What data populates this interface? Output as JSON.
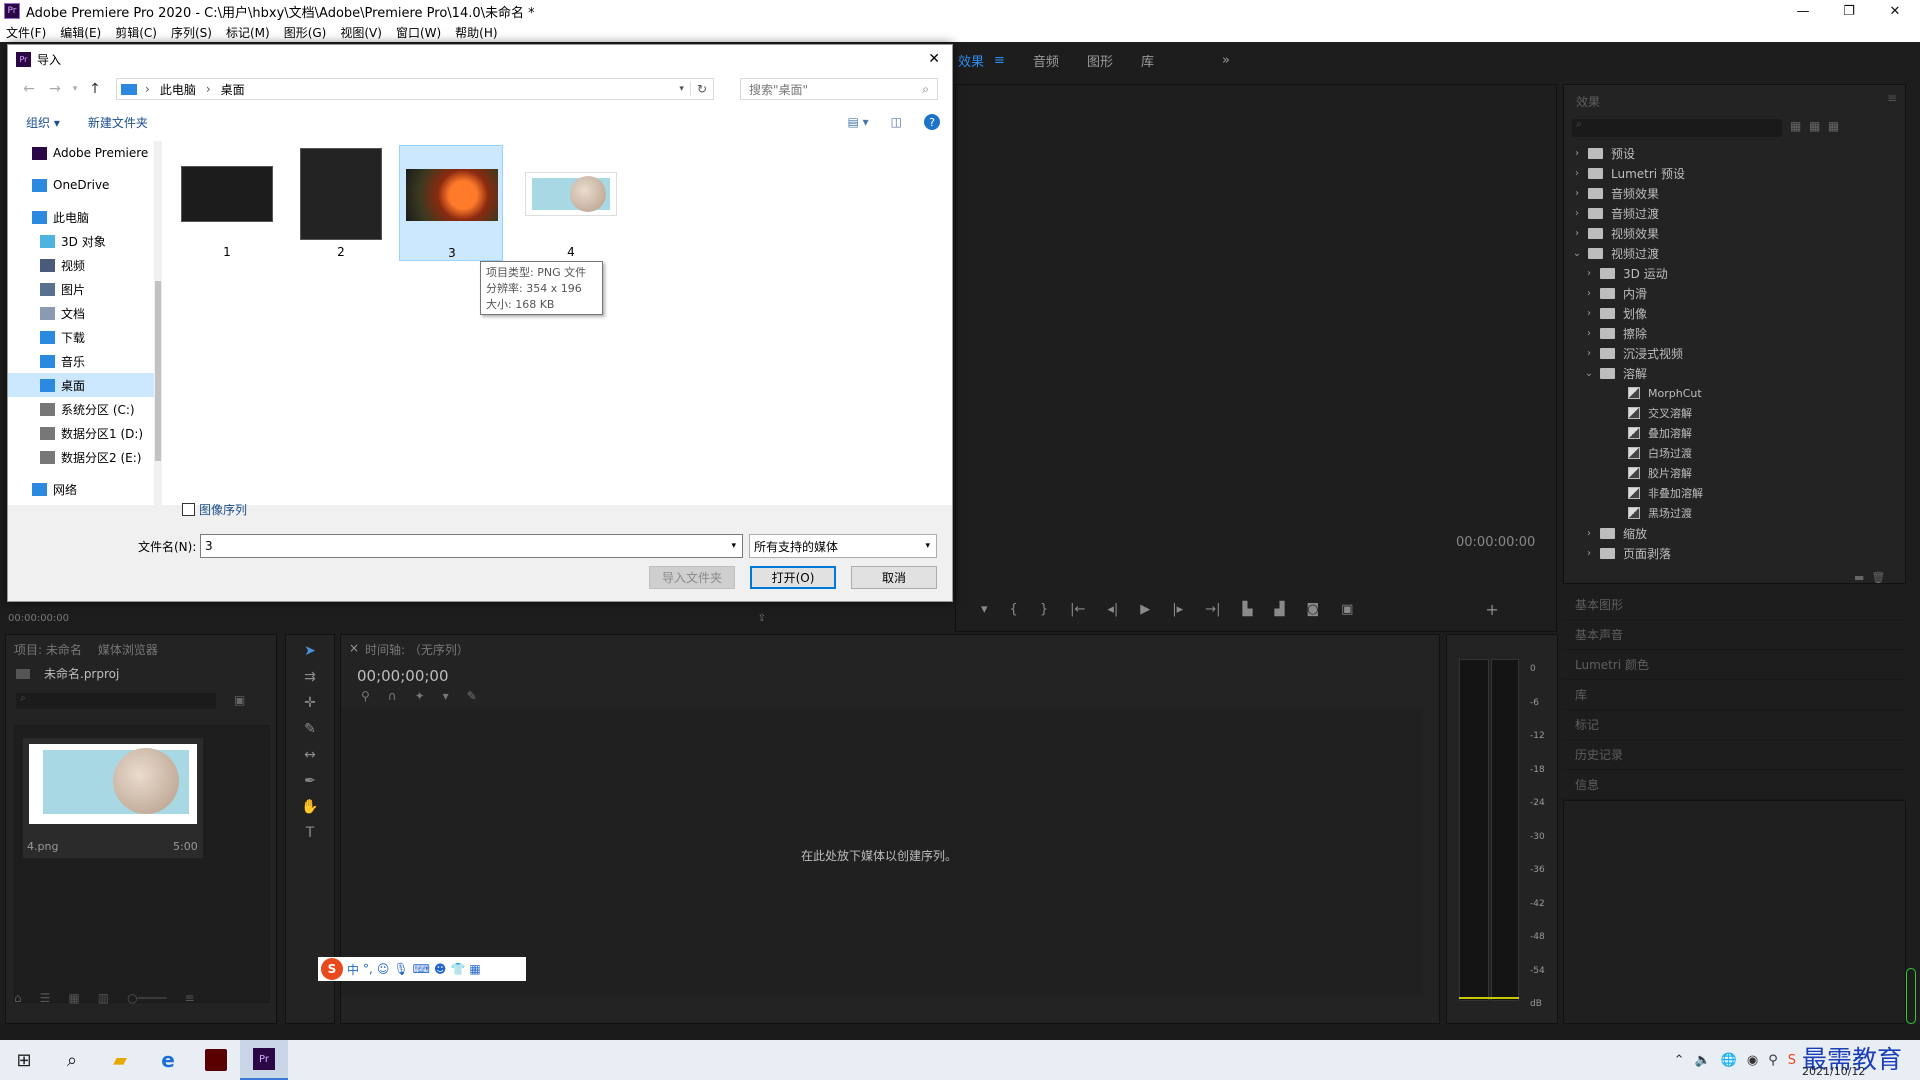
{
  "window": {
    "title": "Adobe Premiere Pro 2020 - C:\\用户\\hbxy\\文档\\Adobe\\Premiere Pro\\14.0\\未命名 *",
    "app_badge": "Pr",
    "minimize": "—",
    "restore": "❐",
    "close": "✕"
  },
  "menu": [
    "文件(F)",
    "编辑(E)",
    "剪辑(C)",
    "序列(S)",
    "标记(M)",
    "图形(G)",
    "视图(V)",
    "窗口(W)",
    "帮助(H)"
  ],
  "workspace_tabs": {
    "effects": "效果",
    "audio": "音频",
    "graphics": "图形",
    "library": "库",
    "more": "»"
  },
  "effects_panel": {
    "title": "效果",
    "items": [
      {
        "label": "预设",
        "level": 0,
        "kind": "folder",
        "open": false
      },
      {
        "label": "Lumetri 预设",
        "level": 0,
        "kind": "folder",
        "open": false
      },
      {
        "label": "音频效果",
        "level": 0,
        "kind": "folder",
        "open": false
      },
      {
        "label": "音频过渡",
        "level": 0,
        "kind": "folder",
        "open": false
      },
      {
        "label": "视频效果",
        "level": 0,
        "kind": "folder",
        "open": false
      },
      {
        "label": "视频过渡",
        "level": 0,
        "kind": "folder",
        "open": true
      },
      {
        "label": "3D 运动",
        "level": 1,
        "kind": "folder",
        "open": false
      },
      {
        "label": "内滑",
        "level": 1,
        "kind": "folder",
        "open": false
      },
      {
        "label": "划像",
        "level": 1,
        "kind": "folder",
        "open": false
      },
      {
        "label": "擦除",
        "level": 1,
        "kind": "folder",
        "open": false
      },
      {
        "label": "沉浸式视频",
        "level": 1,
        "kind": "folder",
        "open": false
      },
      {
        "label": "溶解",
        "level": 1,
        "kind": "folder",
        "open": true
      },
      {
        "label": "MorphCut",
        "level": 2,
        "kind": "effect"
      },
      {
        "label": "交叉溶解",
        "level": 2,
        "kind": "effect"
      },
      {
        "label": "叠加溶解",
        "level": 2,
        "kind": "effect"
      },
      {
        "label": "白场过渡",
        "level": 2,
        "kind": "effect"
      },
      {
        "label": "胶片溶解",
        "level": 2,
        "kind": "effect"
      },
      {
        "label": "非叠加溶解",
        "level": 2,
        "kind": "effect"
      },
      {
        "label": "黑场过渡",
        "level": 2,
        "kind": "effect"
      },
      {
        "label": "缩放",
        "level": 1,
        "kind": "folder",
        "open": false
      },
      {
        "label": "页面剥落",
        "level": 1,
        "kind": "folder",
        "open": false
      }
    ]
  },
  "right_panels": [
    "基本图形",
    "基本声音",
    "Lumetri 颜色",
    "库",
    "标记",
    "历史记录",
    "信息"
  ],
  "program_monitor": {
    "timecode": "00:00:00:00"
  },
  "source_timecode": "00:00:00:00",
  "project_panel": {
    "tab": "项目: 未命名",
    "tab2": "媒体浏览器",
    "file": "未命名.prproj",
    "clip_name": "4.png",
    "clip_duration": "5:00"
  },
  "timeline": {
    "tab": "时间轴: （无序列）",
    "timecode": "00;00;00;00",
    "empty_msg": "在此处放下媒体以创建序列。",
    "close": "×"
  },
  "meter": {
    "labels": [
      "0",
      "-6",
      "-12",
      "-18",
      "-24",
      "-30",
      "-36",
      "-42",
      "-48",
      "-54",
      "dB"
    ]
  },
  "dialog": {
    "title": "导入",
    "badge": "Pr",
    "close": "✕",
    "path": [
      "此电脑",
      "桌面"
    ],
    "search_placeholder": "搜索\"桌面\"",
    "organize": "组织 ▾",
    "new_folder": "新建文件夹",
    "sidebar": [
      {
        "label": "Adobe Premiere",
        "icon": "premiere-icon"
      },
      {
        "label": "OneDrive",
        "icon": "cloud-icon"
      },
      {
        "label": "此电脑",
        "icon": "computer-icon"
      },
      {
        "label": "3D 对象",
        "icon": "cube-icon"
      },
      {
        "label": "视频",
        "icon": "video-icon"
      },
      {
        "label": "图片",
        "icon": "picture-icon"
      },
      {
        "label": "文档",
        "icon": "document-icon"
      },
      {
        "label": "下载",
        "icon": "download-icon"
      },
      {
        "label": "音乐",
        "icon": "music-icon"
      },
      {
        "label": "桌面",
        "icon": "desktop-icon"
      },
      {
        "label": "系统分区 (C:)",
        "icon": "drive-icon"
      },
      {
        "label": "数据分区1 (D:)",
        "icon": "drive-icon"
      },
      {
        "label": "数据分区2 (E:)",
        "icon": "drive-icon"
      },
      {
        "label": "网络",
        "icon": "network-icon"
      }
    ],
    "files": [
      {
        "name": "1"
      },
      {
        "name": "2"
      },
      {
        "name": "3"
      },
      {
        "name": "4"
      }
    ],
    "tooltip": [
      "项目类型: PNG 文件",
      "分辨率: 354 x 196",
      "大小: 168 KB"
    ],
    "image_sequence": "图像序列",
    "filename_label": "文件名(N):",
    "filename_value": "3",
    "filetype": "所有支持的媒体",
    "import_folder": "导入文件夹",
    "open": "打开(O)",
    "cancel": "取消"
  },
  "ime": {
    "logo": "S",
    "label": "中"
  },
  "taskbar": {
    "date": "2021/10/12",
    "watermark": "最需教育",
    "pr_badge": "Pr"
  }
}
